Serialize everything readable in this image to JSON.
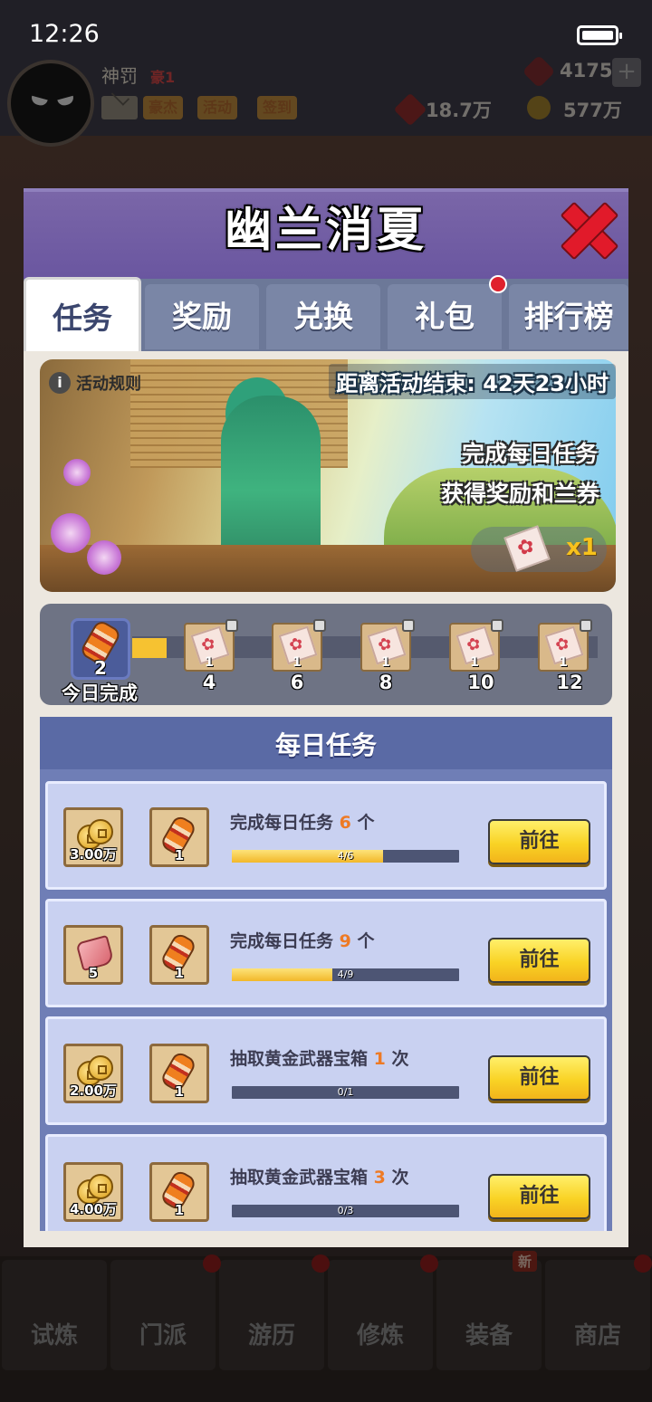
{
  "status_bar": {
    "time": "12:26"
  },
  "player": {
    "name": "神罚",
    "vip": "豪1"
  },
  "top_buttons": [
    "豪杰",
    "活动",
    "签到"
  ],
  "resources": {
    "gems": "4175",
    "power": "18.7万",
    "coins": "577万"
  },
  "modal": {
    "title": "幽兰消夏",
    "tabs": [
      "任务",
      "奖励",
      "兑换",
      "礼包",
      "排行榜"
    ],
    "active_tab": "任务"
  },
  "banner": {
    "rules_label": "活动规则",
    "countdown": "距离活动结束: 42天23小时",
    "line1": "完成每日任务",
    "line2": "获得奖励和兰券",
    "ticket_count": "x1"
  },
  "progress": {
    "today_count": "2",
    "today_label": "今日完成",
    "milestones": [
      {
        "label": "4",
        "qty": "1"
      },
      {
        "label": "6",
        "qty": "1"
      },
      {
        "label": "8",
        "qty": "1"
      },
      {
        "label": "10",
        "qty": "1"
      },
      {
        "label": "12",
        "qty": "1"
      }
    ]
  },
  "daily": {
    "header": "每日任务",
    "tasks": [
      {
        "pre": "完成每日任务 ",
        "num": "6",
        "post": " 个",
        "progress_text": "4/6",
        "progress": 0.667,
        "reward1_qty": "3.00万",
        "reward2_qty": "1",
        "button": "前往"
      },
      {
        "pre": "完成每日任务 ",
        "num": "9",
        "post": " 个",
        "progress_text": "4/9",
        "progress": 0.444,
        "reward1_qty": "5",
        "reward2_qty": "1",
        "button": "前往"
      },
      {
        "pre": "抽取黄金武器宝箱 ",
        "num": "1",
        "post": " 次",
        "progress_text": "0/1",
        "progress": 0,
        "reward1_qty": "2.00万",
        "reward2_qty": "1",
        "button": "前往"
      },
      {
        "pre": "抽取黄金武器宝箱 ",
        "num": "3",
        "post": " 次",
        "progress_text": "0/3",
        "progress": 0,
        "reward1_qty": "4.00万",
        "reward2_qty": "1",
        "button": "前往"
      }
    ]
  },
  "bottom_nav": [
    "试炼",
    "门派",
    "游历",
    "修炼",
    "装备",
    "商店"
  ],
  "bottom_badge": "新"
}
